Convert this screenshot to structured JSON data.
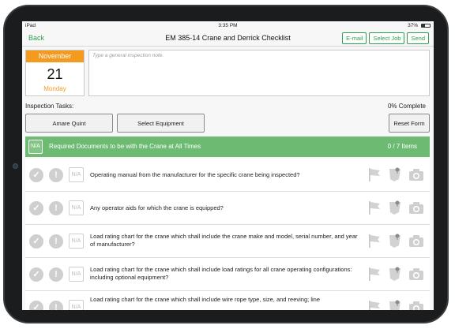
{
  "status": {
    "carrier": "iPad",
    "time": "3:35 PM",
    "battery": "37%"
  },
  "nav": {
    "back": "Back",
    "title": "EM 385-14 Crane and Derrick Checklist",
    "buttons": [
      "E-mail",
      "Select Job",
      "Send"
    ]
  },
  "date": {
    "month": "November",
    "day": "21",
    "weekday": "Monday"
  },
  "note": {
    "placeholder": "Type a general inspection note."
  },
  "tasks": {
    "label": "Inspection Tasks:",
    "completion": "0% Complete",
    "inspector_button": "Amare Quint",
    "equipment_button": "Select Equipment",
    "reset_button": "Reset Form"
  },
  "section": {
    "na": "N/A",
    "title": "Required Documents to be with the Crane at All Times",
    "count": "0 / 7 Items"
  },
  "items": [
    {
      "na": "N/A",
      "text": "Operating manual from the manufacturer for the specific crane being inspected?"
    },
    {
      "na": "N/A",
      "text": "Any operator aids for which the crane is equipped?"
    },
    {
      "na": "N/A",
      "text": "Load rating chart for the crane which shall include the crane make and model, serial number, and year of manufacturer?"
    },
    {
      "na": "N/A",
      "text": "Load rating chart for the crane which shall include load ratings for all crane operating configurations: including optional equipment?"
    },
    {
      "na": "N/A",
      "text": "Load rating chart for the crane which shall include wire rope type, size, and reeving; line"
    }
  ],
  "icons": {
    "check": "check-icon",
    "exclamation": "exclamation-icon",
    "flag": "flag-icon",
    "pin": "pushpin-icon",
    "camera": "camera-icon"
  },
  "colors": {
    "accent": "#2e9e4f",
    "section": "#6dbb72",
    "month": "#f39a1f"
  }
}
